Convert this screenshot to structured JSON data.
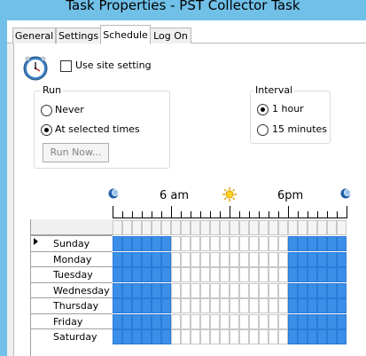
{
  "window": {
    "title": "Task Properties - PST Collector Task"
  },
  "tabs": [
    {
      "label": "General"
    },
    {
      "label": "Settings"
    },
    {
      "label": "Schedule",
      "selected": true
    },
    {
      "label": "Log On"
    }
  ],
  "use_site_setting": {
    "label": "Use site setting",
    "checked": false
  },
  "run_group": {
    "title": "Run",
    "options": [
      {
        "label": "Never",
        "selected": false
      },
      {
        "label": "At selected times",
        "selected": true
      }
    ],
    "run_now_label": "Run Now..."
  },
  "interval_group": {
    "title": "Interval",
    "options": [
      {
        "label": "1 hour",
        "selected": true
      },
      {
        "label": "15 minutes",
        "selected": false
      }
    ]
  },
  "time_axis": {
    "label_6am": "6 am",
    "label_6pm": "6pm"
  },
  "schedule": {
    "days": [
      "Sunday",
      "Monday",
      "Tuesday",
      "Wednesday",
      "Thursday",
      "Friday",
      "Saturday"
    ],
    "active_hours": [
      0,
      1,
      2,
      3,
      4,
      5,
      18,
      19,
      20,
      21,
      22,
      23
    ],
    "hours_per_day": 24
  },
  "colors": {
    "selected_cell": "#3b8fe8",
    "title_bar": "#70c0e8"
  }
}
